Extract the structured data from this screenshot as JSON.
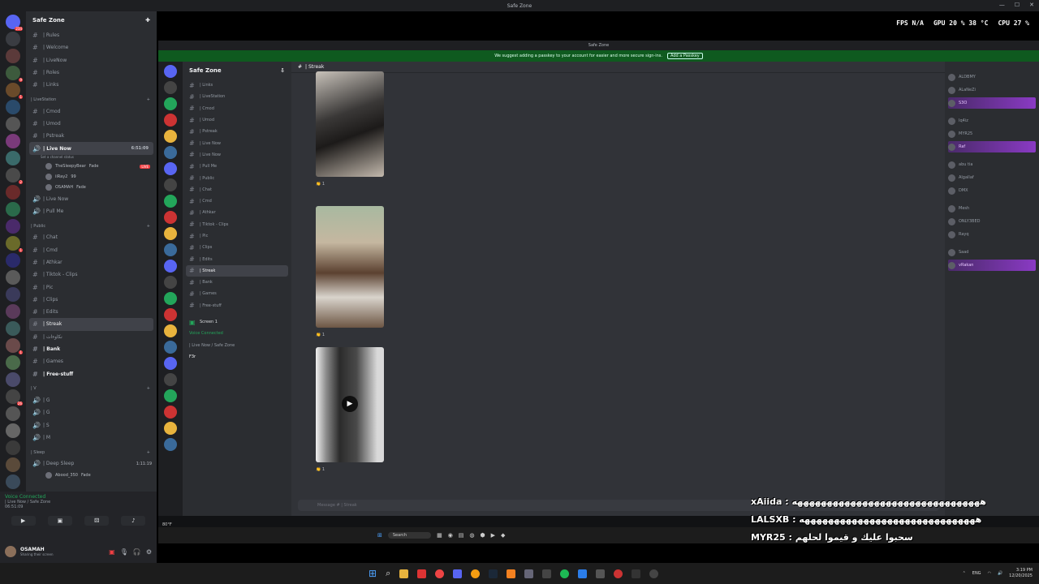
{
  "window": {
    "title": "Safe Zone",
    "controls": [
      "—",
      "☐",
      "✕"
    ]
  },
  "server_rail": {
    "badges": [
      "234",
      "",
      "",
      "9",
      "1",
      "",
      "",
      "",
      "",
      "2",
      "",
      "",
      "",
      "1",
      "",
      "",
      "",
      "",
      "",
      "1",
      "",
      "",
      "26",
      "",
      "",
      "",
      "",
      "",
      "",
      "",
      "",
      "",
      ""
    ]
  },
  "sidebar": {
    "guild_name": "Safe Zone",
    "top_channels": [
      {
        "label": "| Rules"
      },
      {
        "label": "| Welcome"
      },
      {
        "label": "| LiveNow"
      },
      {
        "label": "| Roles"
      },
      {
        "label": "| Links"
      }
    ],
    "cat_livestation": "| LiveStation",
    "livestation_channels": [
      {
        "label": "| Cmod"
      },
      {
        "label": "| Umod"
      },
      {
        "label": "| Pstreak"
      }
    ],
    "live_now": {
      "label": "| Live Now",
      "time": "6:51:09",
      "status": "Set a channel status"
    },
    "voice_users": [
      {
        "name": "TheSleepyBear",
        "badge": "Fade",
        "live": "LIVE"
      },
      {
        "name": "iiRay2",
        "badge": "99",
        "live": ""
      },
      {
        "name": "OSAMAH",
        "badge": "Fade",
        "live": ""
      }
    ],
    "other_voice": [
      {
        "label": "| Live Now"
      },
      {
        "label": "| Pull Me"
      }
    ],
    "cat_public": "| Public",
    "public_channels": [
      {
        "label": "| Chat"
      },
      {
        "label": "| Cmd"
      },
      {
        "label": "| Athkar"
      },
      {
        "label": "| Tiktok - Clips"
      },
      {
        "label": "| Pic"
      },
      {
        "label": "| Clips"
      },
      {
        "label": "| Edits"
      },
      {
        "label": "| Streak"
      },
      {
        "label": "| نكاوءات"
      },
      {
        "label": "| Bank"
      },
      {
        "label": "| Games"
      },
      {
        "label": "| Free-stuff"
      }
    ],
    "cat_v": "| V",
    "v_channels": [
      {
        "label": "| G"
      },
      {
        "label": "| G"
      },
      {
        "label": "| S"
      },
      {
        "label": "| M"
      }
    ],
    "cat_sleep": "| Sleep",
    "deep_sleep": {
      "label": "| Deep Sleep",
      "time": "1:11:19"
    },
    "deep_sleep_user": {
      "name": "Abood_350",
      "badge": "Fade"
    }
  },
  "voice_panel": {
    "status": "Voice Connected",
    "channel": "| Live Now / Safe Zone",
    "time": "06:51:09"
  },
  "user_panel": {
    "name": "OSAMAH",
    "status": "Sharing their screen"
  },
  "stream": {
    "title": "Safe Zone",
    "banner_text": "We suggest adding a passkey to your account for easier and more secure sign-ins.",
    "banner_button": "Add a Passkey",
    "fps_label": "FPS",
    "fps_value": "N/A",
    "gpu_label": "GPU",
    "gpu_value": "20 %",
    "gpu_temp": "38 °C",
    "cpu_label": "CPU",
    "cpu_value": "27 %",
    "guild_name": "Safe Zone",
    "channel_header": "| Streak",
    "side_channels": [
      {
        "label": "| Links"
      },
      {
        "label": "| LiveStation"
      },
      {
        "label": "| Cmod"
      },
      {
        "label": "| Umod"
      },
      {
        "label": "| Pstreak"
      },
      {
        "label": "| Live Now"
      },
      {
        "label": "| Live Now"
      },
      {
        "label": "| Pull Me"
      },
      {
        "label": "| Public"
      },
      {
        "label": "| Chat"
      },
      {
        "label": "| Cmd"
      },
      {
        "label": "| Athkar"
      },
      {
        "label": "| Tiktok - Clips"
      },
      {
        "label": "| Pic"
      },
      {
        "label": "| Clips"
      },
      {
        "label": "| Edits"
      },
      {
        "label": "| Streak"
      },
      {
        "label": "| Bank"
      },
      {
        "label": "| Games"
      },
      {
        "label": "| Free-stuff"
      }
    ],
    "screen_label": "Screen 1",
    "voice_connected": "Voice Connected",
    "voice_channel": "| Live Now / Safe Zone",
    "user_name": "F3r",
    "reactions": [
      "👏 1",
      "👏 1",
      "👏 1"
    ],
    "message_placeholder": "Message # | Streak",
    "members": [
      {
        "group": "",
        "name": "ALDBMY",
        "hl": false
      },
      {
        "group": "",
        "name": "ALaNeZi",
        "hl": false
      },
      {
        "group": "",
        "name": "S3O",
        "hl": true
      },
      {
        "group": "",
        "name": "Iq4iz",
        "hl": false
      },
      {
        "group": "",
        "name": "MYR25",
        "hl": false
      },
      {
        "group": "",
        "name": "Raf",
        "hl": true
      },
      {
        "group": "",
        "name": "abu tia",
        "hl": false
      },
      {
        "group": "",
        "name": "Algallaf",
        "hl": false
      },
      {
        "group": "",
        "name": "DMX",
        "hl": false
      },
      {
        "group": "",
        "name": "Mesh",
        "hl": false
      },
      {
        "group": "",
        "name": "ONLY3BED",
        "hl": false
      },
      {
        "group": "",
        "name": "Rayq",
        "hl": false
      },
      {
        "group": "",
        "name": "Saad",
        "hl": false
      },
      {
        "group": "",
        "name": "vRakan",
        "hl": true
      }
    ],
    "search": "Search"
  },
  "chat_overlay": [
    {
      "user": "xAiida",
      "msg": "ههههههههههههههههههههههههههههههههه"
    },
    {
      "user": "LALSXB",
      "msg": "ههههههههههههههههههههههههههههههه"
    },
    {
      "user": "MYR25",
      "msg": "سحبوا عليك و قيموا لحلهم"
    }
  ],
  "weather": "80°F",
  "taskbar": {
    "lang": "ENG",
    "time": "3:19 PM",
    "date": "12/20/2025"
  }
}
